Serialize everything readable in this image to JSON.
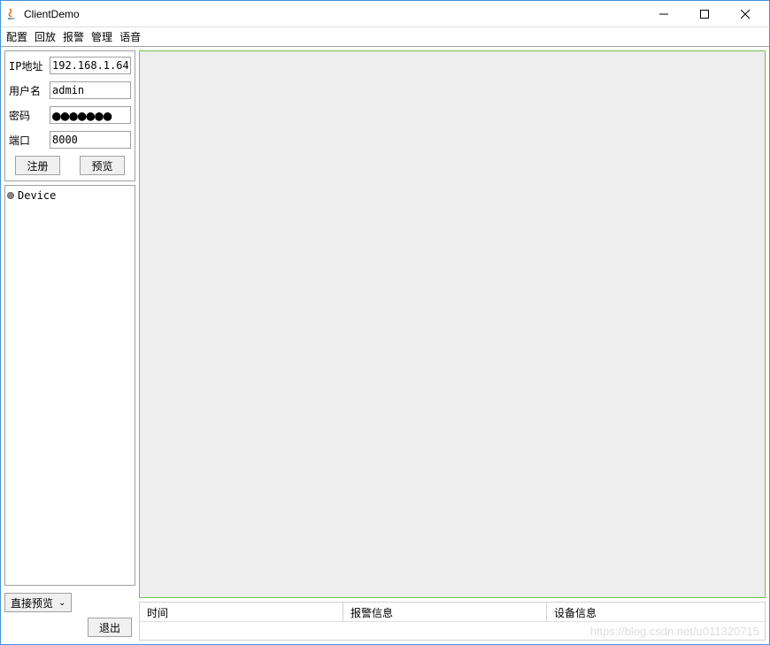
{
  "window": {
    "title": "ClientDemo"
  },
  "menu": {
    "items": [
      "配置",
      "回放",
      "报警",
      "管理",
      "语音"
    ]
  },
  "form": {
    "ip_label": "IP地址",
    "ip_value": "192.168.1.64",
    "user_label": "用户名",
    "user_value": "admin",
    "pw_label": "密码",
    "pw_value": "●●●●●●●",
    "port_label": "端口",
    "port_value": "8000",
    "register_label": "注册",
    "preview_label": "预览"
  },
  "tree": {
    "root": "Device"
  },
  "bottom": {
    "mode_label": "直接预览",
    "exit_label": "退出"
  },
  "table": {
    "col_time": "时间",
    "col_alarm": "报警信息",
    "col_device": "设备信息"
  },
  "watermark": "https://blog.csdn.net/u011320715"
}
